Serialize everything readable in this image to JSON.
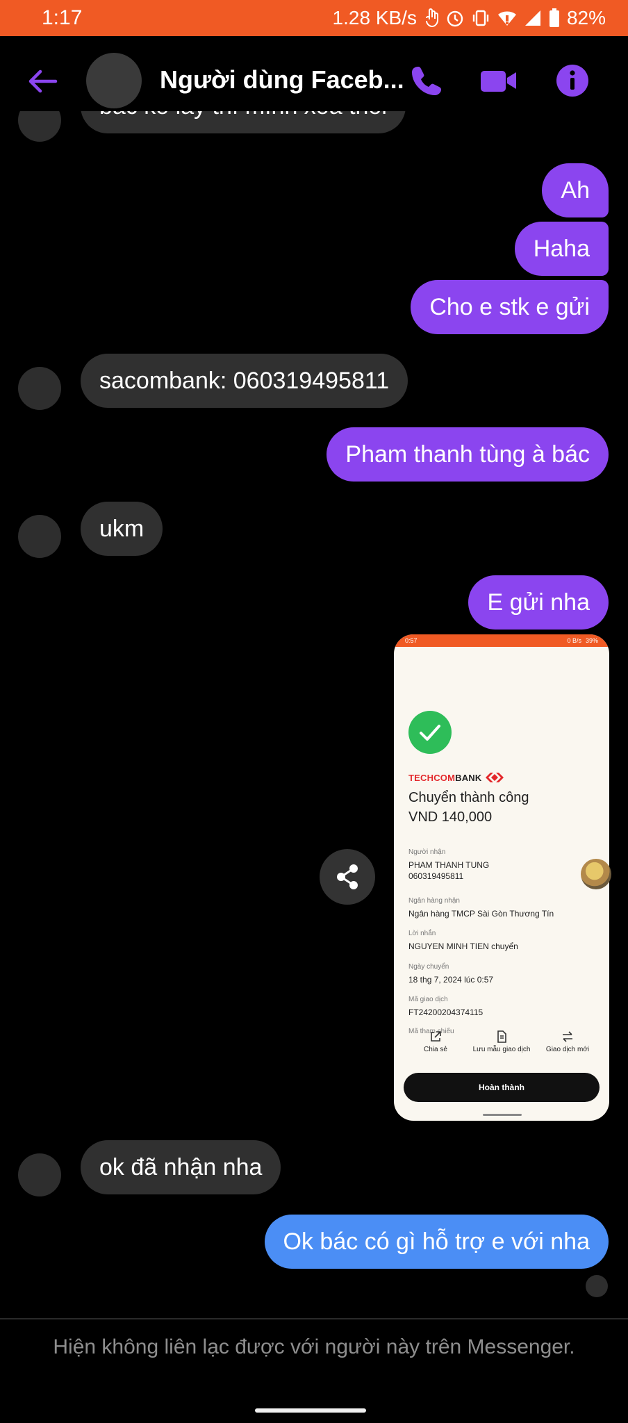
{
  "status_bar": {
    "time": "1:17",
    "net_speed": "1.28 KB/s",
    "battery": "82%"
  },
  "header": {
    "title": "Người dùng Faceb...",
    "colors": {
      "accent": "#8b45ef"
    },
    "icons": [
      "back-arrow-icon",
      "phone-icon",
      "video-icon",
      "info-icon"
    ]
  },
  "messages": [
    {
      "side": "in",
      "text": "bác ko lấy thì mình xóa thôi"
    },
    {
      "side": "out",
      "text": "Ah"
    },
    {
      "side": "out",
      "text": "Haha"
    },
    {
      "side": "out",
      "text": "Cho e stk e gửi"
    },
    {
      "side": "in",
      "text": "sacombank: 060319495811"
    },
    {
      "side": "out",
      "text": "Pham thanh tùng à bác"
    },
    {
      "side": "in",
      "text": "ukm"
    },
    {
      "side": "out",
      "text": "E gửi nha"
    },
    {
      "side": "in",
      "text": "ok đã nhận nha"
    },
    {
      "side": "out",
      "text": "Ok bác có gì hỗ trợ e với nha"
    }
  ],
  "shared_image": {
    "status_left": "0:57",
    "status_right": "0 B/s",
    "status_battery": "39%",
    "logo_tech": "TECHCOM",
    "logo_bank": "BANK",
    "title": "Chuyển thành công",
    "amount": "VND 140,000",
    "fields": [
      {
        "label": "Người nhận",
        "value": "PHAM THANH TUNG\n060319495811"
      },
      {
        "label": "Ngân hàng nhận",
        "value": "Ngân hàng TMCP Sài Gòn Thương Tín"
      },
      {
        "label": "Lời nhắn",
        "value": "NGUYEN MINH TIEN chuyển"
      },
      {
        "label": "Ngày chuyển",
        "value": "18 thg 7, 2024 lúc 0:57"
      },
      {
        "label": "Mã giao dịch",
        "value": "FT24200204374115"
      },
      {
        "label": "Mã tham chiếu",
        "value": ""
      }
    ],
    "actions": [
      "Chia sẻ",
      "Lưu mẫu giao dịch",
      "Giao dịch mới"
    ],
    "done_label": "Hoàn thành"
  },
  "footer": {
    "notice": "Hiện không liên lạc được với người này trên Messenger."
  }
}
